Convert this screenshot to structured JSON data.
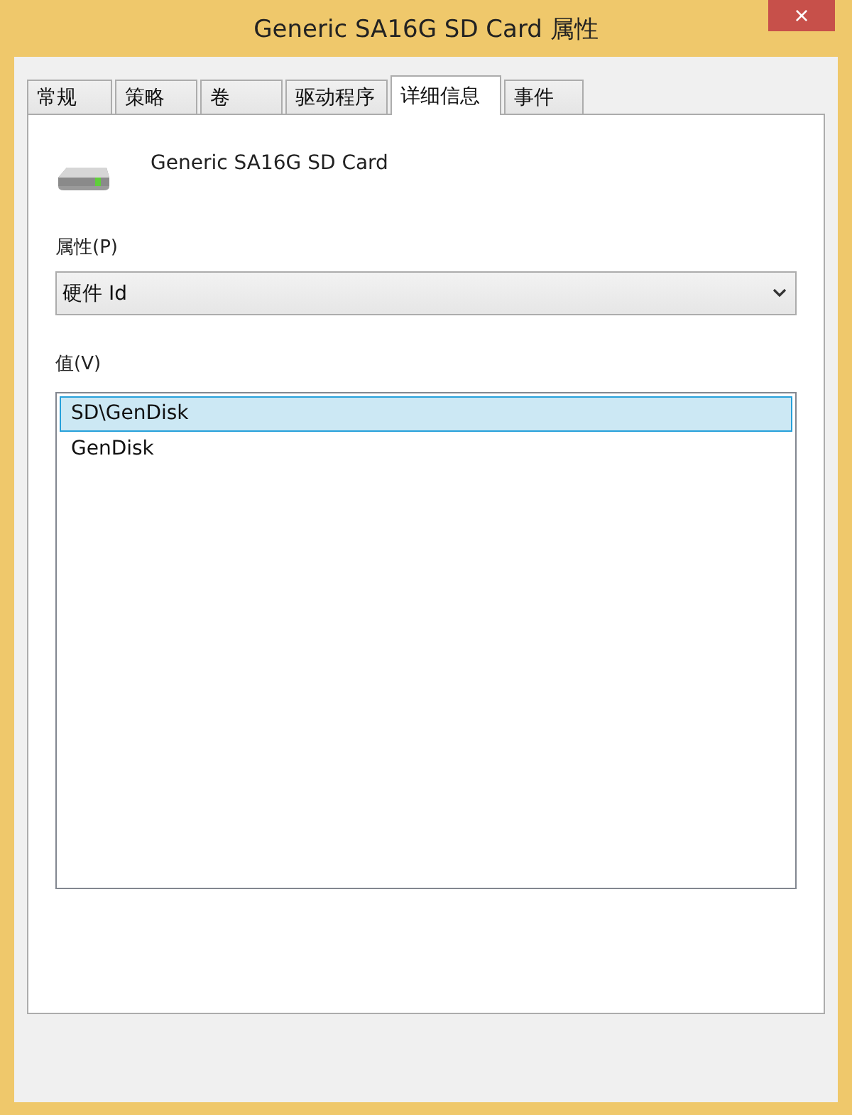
{
  "window": {
    "title": "Generic SA16G SD Card 属性",
    "close": "×"
  },
  "tabs": [
    {
      "label": "常规",
      "selected": false
    },
    {
      "label": "策略",
      "selected": false
    },
    {
      "label": "卷",
      "selected": false
    },
    {
      "label": "驱动程序",
      "selected": false
    },
    {
      "label": "详细信息",
      "selected": true
    },
    {
      "label": "事件",
      "selected": false
    }
  ],
  "device": {
    "name": "Generic SA16G SD Card"
  },
  "property": {
    "label": "属性(P)",
    "value": "硬件 Id"
  },
  "values": {
    "label": "值(V)",
    "items": [
      {
        "text": "SD\\GenDisk",
        "selected": true
      },
      {
        "text": "GenDisk",
        "selected": false
      }
    ]
  }
}
